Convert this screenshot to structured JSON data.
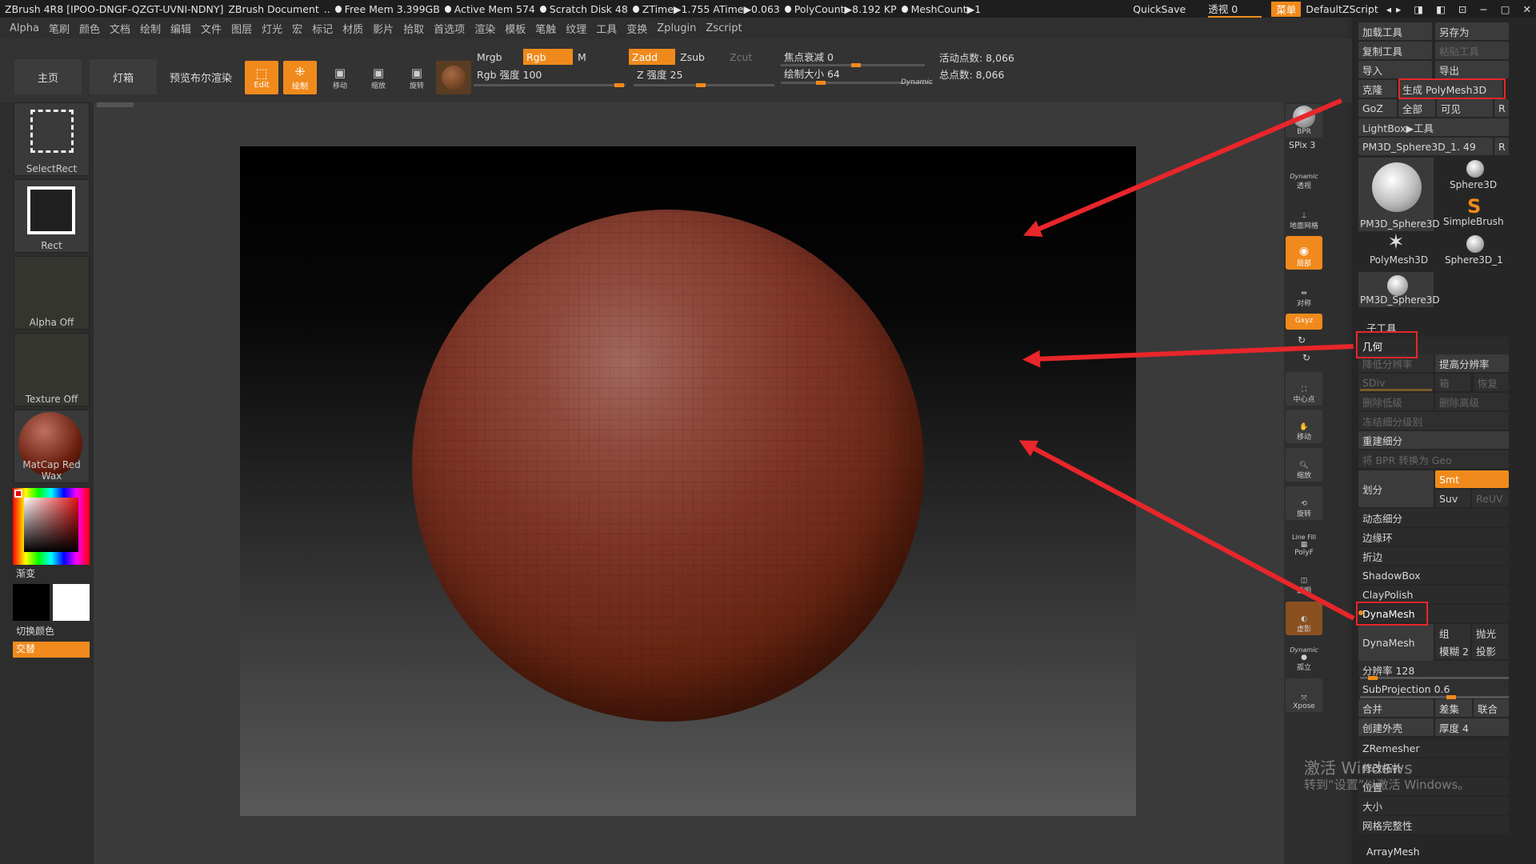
{
  "titlebar": {
    "app": "ZBrush 4R8 [IPOO-DNGF-QZGT-UVNI-NDNY]",
    "doc": "ZBrush Document",
    "free_mem": "Free Mem 3.399GB",
    "active_mem": "Active Mem 574",
    "scratch": "Scratch Disk 48",
    "ztime": "ZTime▶1.755 ATime▶0.063",
    "polycount": "PolyCount▶8.192 KP",
    "meshcount": "MeshCount▶1",
    "quicksave": "QuickSave",
    "see_through": "透视  0",
    "menu": "菜单",
    "script": "DefaultZScript"
  },
  "menu": [
    "Alpha",
    "笔刷",
    "颜色",
    "文档",
    "绘制",
    "编辑",
    "文件",
    "图层",
    "灯光",
    "宏",
    "标记",
    "材质",
    "影片",
    "拾取",
    "首选项",
    "渲染",
    "模板",
    "笔触",
    "纹理",
    "工具",
    "变换",
    "Zplugin",
    "Zscript"
  ],
  "toolbar": {
    "home": "主页",
    "lightbox": "灯箱",
    "bpr": "预览布尔渲染",
    "edit": "Edit",
    "draw": "绘制",
    "move": "移动",
    "scale": "缩放",
    "rotate": "旋转",
    "mrgb": "Mrgb",
    "rgb": "Rgb",
    "m": "M",
    "zadd": "Zadd",
    "zsub": "Zsub",
    "zcut": "Zcut",
    "rgb_intensity": "Rgb 强度 100",
    "z_intensity": "Z 强度 25",
    "focal_shift": "焦点衰减 0",
    "draw_size": "绘制大小 64",
    "dynamic": "Dynamic",
    "active_points": "活动点数: 8,066",
    "total_points": "总点数: 8,066"
  },
  "left": {
    "selectrect": "SelectRect",
    "rect": "Rect",
    "alpha": "Alpha Off",
    "texture": "Texture Off",
    "matcap": "MatCap Red Wax",
    "gradient": "渐变",
    "switch_color": "切换颜色",
    "alternate": "交替"
  },
  "shelf": {
    "bpr": "BPR",
    "spix": "SPix 3",
    "dynamic": "Dynamic",
    "persp": "透视",
    "floor": "地面网格",
    "local": "局部",
    "symmetry": "对称",
    "xyz": "Gxyz",
    "frame": "中心点",
    "move": "移动",
    "zoom": "缩放",
    "rotate": "旋转",
    "linefill": "Line Fill",
    "polyf": "PolyF",
    "transp": "透明",
    "ghost": "虚影",
    "solo": "孤立",
    "xpose": "Xpose"
  },
  "panel": {
    "load_tool": "加载工具",
    "save_as": "另存为",
    "copy_tool": "复制工具",
    "paste_tool": "粘贴工具",
    "import": "导入",
    "export": "导出",
    "clone": "克隆",
    "make_polymesh": "生成 PolyMesh3D",
    "goz": "GoZ",
    "all": "全部",
    "visible": "可见",
    "r": "R",
    "lightbox_tools": "LightBox▶工具",
    "current_tool": "PM3D_Sphere3D_1. 49",
    "tools": [
      "PM3D_Sphere3D",
      "Sphere3D",
      "SimpleBrush",
      "PolyMesh3D",
      "Sphere3D_1",
      "PM3D_Sphere3D"
    ],
    "subtool": "子工具",
    "geometry": "几何",
    "lower_res": "降低分辨率",
    "higher_res": "提高分辨率",
    "sdiv": "SDiv",
    "cage": "箱",
    "restore": "恢复",
    "del_lower": "删除低级",
    "del_higher": "删除高级",
    "freeze": "冻结细分级别",
    "reconstruct": "重建细分",
    "bpr_geo": "将 BPR 转换为 Geo",
    "divide": "划分",
    "smt": "Smt",
    "suv": "Suv",
    "reuv": "ReUV",
    "dynamic_sub": "动态细分",
    "edgeloop": "边缘环",
    "crease": "折边",
    "shadowbox": "ShadowBox",
    "claypolish": "ClayPolish",
    "dynamesh_header": "DynaMesh",
    "dynamesh_btn": "DynaMesh",
    "group": "组",
    "polish": "抛光",
    "blur": "模糊 2",
    "project": "投影",
    "resolution": "分辨率 128",
    "subprojection": "SubProjection 0.6",
    "merge": "合并",
    "diff": "差集",
    "union": "联合",
    "create_shell": "创建外壳",
    "thickness": "厚度 4",
    "zremesher": "ZRemesher",
    "modify_topo": "修改拓扑",
    "position": "位置",
    "size": "大小",
    "mesh_integrity": "网格完整性",
    "arraymesh": "ArrayMesh"
  },
  "watermark": {
    "line1": "激活 Windows",
    "line2": "转到“设置”以激活 Windows。"
  },
  "colors": {
    "accent": "#f08a1c",
    "annotation": "#e8262b",
    "sphere": "#7c3426"
  }
}
